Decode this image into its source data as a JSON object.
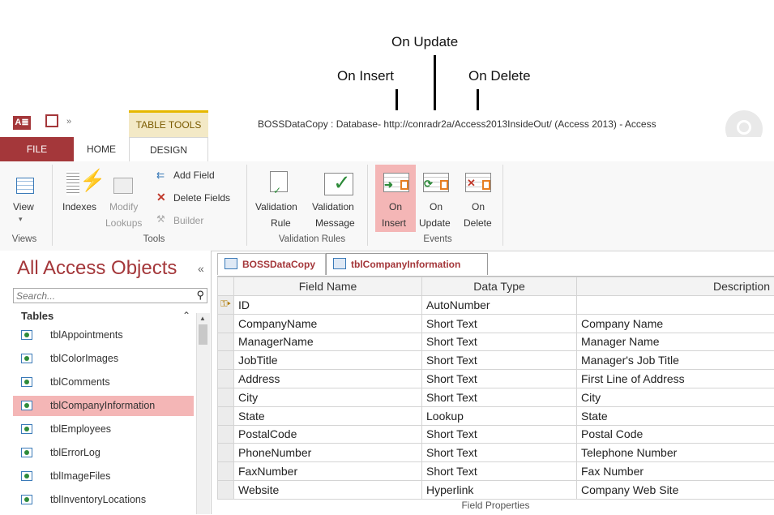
{
  "callouts": {
    "on_update": "On Update",
    "on_insert": "On Insert",
    "on_delete": "On Delete"
  },
  "titlebar": {
    "app_icon": "A≣",
    "table_tools": "TABLE TOOLS",
    "title": "BOSSDataCopy : Database- http://conradr2a/Access2013InsideOut/ (Access 2013) - Access"
  },
  "tabs": {
    "file": "FILE",
    "home": "HOME",
    "design": "DESIGN"
  },
  "ribbon": {
    "view": "View",
    "indexes": "Indexes",
    "modify": "Modify",
    "lookups": "Lookups",
    "add_field": "Add Field",
    "delete_fields": "Delete Fields",
    "builder": "Builder",
    "validation1": "Validation",
    "rule": "Rule",
    "validation2": "Validation",
    "message": "Message",
    "on1": "On",
    "insert": "Insert",
    "on2": "On",
    "update": "Update",
    "on3": "On",
    "delete": "Delete",
    "groups": {
      "views": "Views",
      "tools": "Tools",
      "validation_rules": "Validation Rules",
      "events": "Events"
    }
  },
  "nav": {
    "title": "All Access Objects",
    "collapse": "«",
    "search_placeholder": "Search...",
    "section": "Tables",
    "section_toggle": "⌃",
    "items": [
      "tblAppointments",
      "tblColorImages",
      "tblComments",
      "tblCompanyInformation",
      "tblEmployees",
      "tblErrorLog",
      "tblImageFiles",
      "tblInventoryLocations"
    ]
  },
  "doc_tabs": [
    "BOSSDataCopy",
    "tblCompanyInformation"
  ],
  "grid": {
    "headers": [
      "Field Name",
      "Data Type",
      "Description"
    ],
    "rows": [
      {
        "field": "ID",
        "type": "AutoNumber",
        "desc": ""
      },
      {
        "field": "CompanyName",
        "type": "Short Text",
        "desc": "Company Name"
      },
      {
        "field": "ManagerName",
        "type": "Short Text",
        "desc": "Manager Name"
      },
      {
        "field": "JobTitle",
        "type": "Short Text",
        "desc": "Manager's Job Title"
      },
      {
        "field": "Address",
        "type": "Short Text",
        "desc": "First Line of Address"
      },
      {
        "field": "City",
        "type": "Short Text",
        "desc": "City"
      },
      {
        "field": "State",
        "type": "Lookup",
        "desc": "State"
      },
      {
        "field": "PostalCode",
        "type": "Short Text",
        "desc": "Postal Code"
      },
      {
        "field": "PhoneNumber",
        "type": "Short Text",
        "desc": "Telephone Number"
      },
      {
        "field": "FaxNumber",
        "type": "Short Text",
        "desc": "Fax Number"
      },
      {
        "field": "Website",
        "type": "Hyperlink",
        "desc": "Company Web Site"
      }
    ],
    "field_properties": "Field Properties"
  },
  "colors": {
    "accent": "#a4373a",
    "selected_item": "#f4b6b6",
    "on_insert_highlight": "#f4b6b6"
  }
}
